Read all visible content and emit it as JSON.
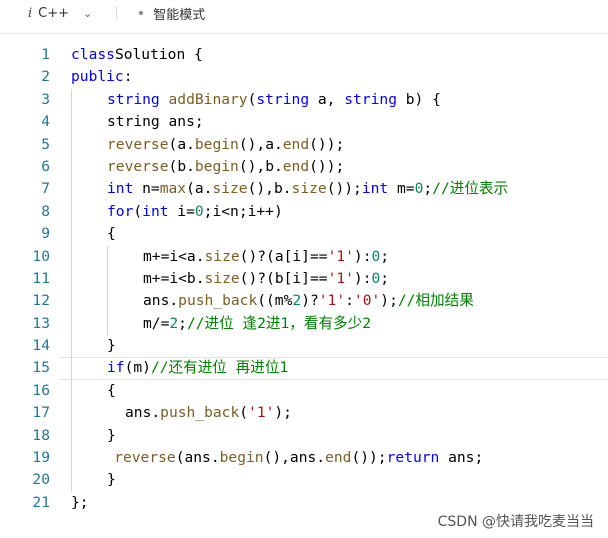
{
  "toolbar": {
    "lang_icon": "i",
    "language": "C++",
    "mode": "智能模式"
  },
  "lines": [
    {
      "n": "1",
      "indent": 0,
      "tokens": [
        [
          "k",
          "class"
        ],
        [
          "",
          "Solution"
        ],
        [
          "",
          " {"
        ]
      ]
    },
    {
      "n": "2",
      "indent": 0,
      "tokens": [
        [
          "k",
          "public"
        ],
        [
          "",
          ":"
        ]
      ]
    },
    {
      "n": "3",
      "indent": 1,
      "tokens": [
        [
          "k",
          "string"
        ],
        [
          "",
          " "
        ],
        [
          "f",
          "addBinary"
        ],
        [
          "",
          "("
        ],
        [
          "k",
          "string"
        ],
        [
          "",
          " a, "
        ],
        [
          "k",
          "string"
        ],
        [
          "",
          " b) {"
        ]
      ]
    },
    {
      "n": "4",
      "indent": 1,
      "tokens": [
        [
          "",
          "string ans;"
        ]
      ]
    },
    {
      "n": "5",
      "indent": 1,
      "tokens": [
        [
          "f",
          "reverse"
        ],
        [
          "",
          "("
        ],
        [
          "",
          "a."
        ],
        [
          "f",
          "begin"
        ],
        [
          "",
          "(),"
        ],
        [
          "",
          "a."
        ],
        [
          "f",
          "end"
        ],
        [
          "",
          "());"
        ]
      ]
    },
    {
      "n": "6",
      "indent": 1,
      "tokens": [
        [
          "f",
          "reverse"
        ],
        [
          "",
          "("
        ],
        [
          "",
          "b."
        ],
        [
          "f",
          "begin"
        ],
        [
          "",
          "(),"
        ],
        [
          "",
          "b."
        ],
        [
          "f",
          "end"
        ],
        [
          "",
          "());"
        ]
      ]
    },
    {
      "n": "7",
      "indent": 1,
      "tokens": [
        [
          "k",
          "int"
        ],
        [
          "",
          " n="
        ],
        [
          "f",
          "max"
        ],
        [
          "",
          "(a."
        ],
        [
          "f",
          "size"
        ],
        [
          "",
          "(),b."
        ],
        [
          "f",
          "size"
        ],
        [
          "",
          "());"
        ],
        [
          "k",
          "int"
        ],
        [
          "",
          " m="
        ],
        [
          "n",
          "0"
        ],
        [
          "",
          ";"
        ],
        [
          "c",
          "//进位表示"
        ]
      ]
    },
    {
      "n": "8",
      "indent": 1,
      "tokens": [
        [
          "k",
          "for"
        ],
        [
          "",
          "("
        ],
        [
          "k",
          "int"
        ],
        [
          "",
          " i="
        ],
        [
          "n",
          "0"
        ],
        [
          "",
          ";i<n;i++)"
        ]
      ]
    },
    {
      "n": "9",
      "indent": 1,
      "tokens": [
        [
          "",
          "{"
        ]
      ]
    },
    {
      "n": "10",
      "indent": 2,
      "tokens": [
        [
          "",
          "m+=i<a."
        ],
        [
          "f",
          "size"
        ],
        [
          "",
          "()?(a[i]=="
        ],
        [
          "s",
          "'1'"
        ],
        [
          "",
          "):"
        ],
        [
          "n",
          "0"
        ],
        [
          "",
          ";"
        ]
      ]
    },
    {
      "n": "11",
      "indent": 2,
      "tokens": [
        [
          "",
          "m+=i<b."
        ],
        [
          "f",
          "size"
        ],
        [
          "",
          "()?(b[i]=="
        ],
        [
          "s",
          "'1'"
        ],
        [
          "",
          "):"
        ],
        [
          "n",
          "0"
        ],
        [
          "",
          ";"
        ]
      ]
    },
    {
      "n": "12",
      "indent": 2,
      "tokens": [
        [
          "",
          "ans."
        ],
        [
          "f",
          "push_back"
        ],
        [
          "",
          "((m%"
        ],
        [
          "n",
          "2"
        ],
        [
          "",
          ")?"
        ],
        [
          "s",
          "'1'"
        ],
        [
          "",
          ":"
        ],
        [
          "s",
          "'0'"
        ],
        [
          "",
          ");"
        ],
        [
          "c",
          "//相加结果"
        ]
      ]
    },
    {
      "n": "13",
      "indent": 2,
      "tokens": [
        [
          "",
          "m/="
        ],
        [
          "n",
          "2"
        ],
        [
          "",
          ";"
        ],
        [
          "c",
          "//进位 逢2进1，看有多少2"
        ]
      ]
    },
    {
      "n": "14",
      "indent": 1,
      "tokens": [
        [
          "",
          "}"
        ]
      ]
    },
    {
      "n": "15",
      "indent": 1,
      "current": true,
      "tokens": [
        [
          "k",
          "if"
        ],
        [
          "",
          "(m)"
        ],
        [
          "c",
          "//还有进位 再进位1"
        ]
      ]
    },
    {
      "n": "16",
      "indent": 1,
      "tokens": [
        [
          "",
          "{"
        ]
      ]
    },
    {
      "n": "17",
      "indent": 1.5,
      "tokens": [
        [
          "",
          "ans."
        ],
        [
          "f",
          "push_back"
        ],
        [
          "",
          "("
        ],
        [
          "s",
          "'1'"
        ],
        [
          "",
          ");"
        ]
      ]
    },
    {
      "n": "18",
      "indent": 1,
      "tokens": [
        [
          "",
          "}"
        ]
      ]
    },
    {
      "n": "19",
      "indent": 1.2,
      "tokens": [
        [
          "f",
          "reverse"
        ],
        [
          "",
          "(ans."
        ],
        [
          "f",
          "begin"
        ],
        [
          "",
          "(),ans."
        ],
        [
          "f",
          "end"
        ],
        [
          "",
          "());"
        ],
        [
          "k",
          "return"
        ],
        [
          "",
          " ans;"
        ]
      ]
    },
    {
      "n": "20",
      "indent": 1,
      "tokens": [
        [
          "",
          "}"
        ]
      ]
    },
    {
      "n": "21",
      "indent": 0,
      "tokens": [
        [
          "",
          "};"
        ]
      ]
    }
  ],
  "watermark": "CSDN @快请我吃麦当当"
}
